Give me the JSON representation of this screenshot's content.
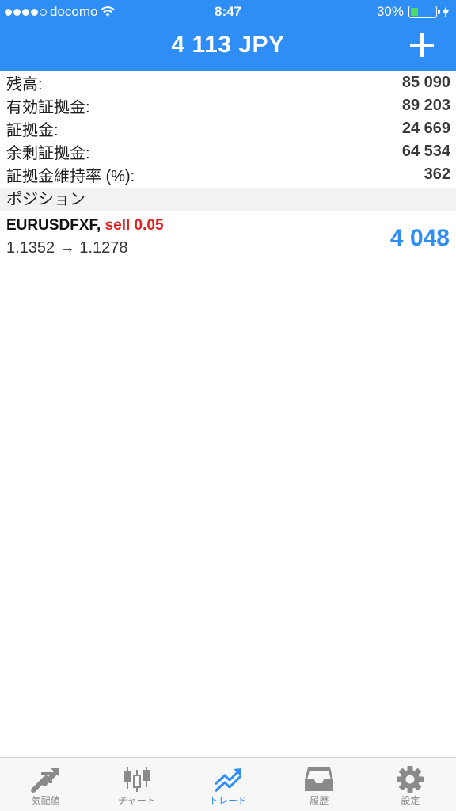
{
  "status_bar": {
    "carrier": "docomo",
    "time": "8:47",
    "battery": "30%",
    "battery_level": 0.3
  },
  "header": {
    "title": "4 113 JPY",
    "add_icon": "plus-icon"
  },
  "account": [
    {
      "label": "残高:",
      "value": "85 090"
    },
    {
      "label": "有効証拠金:",
      "value": "89 203"
    },
    {
      "label": "証拠金:",
      "value": "24 669"
    },
    {
      "label": "余剰証拠金:",
      "value": "64 534"
    },
    {
      "label": "証拠金維持率 (%):",
      "value": "362"
    }
  ],
  "positions_section": {
    "title": "ポジション"
  },
  "position": {
    "symbol": "EURUSDFXF,",
    "side": "sell 0.05",
    "prices": "1.1352 → 1.1278",
    "profit": "4 048"
  },
  "tabs": [
    {
      "label": "気配値",
      "icon": "quotes-arrows-icon",
      "active": false
    },
    {
      "label": "チャート",
      "icon": "candlestick-chart-icon",
      "active": false
    },
    {
      "label": "トレード",
      "icon": "trade-trend-icon",
      "active": true
    },
    {
      "label": "履歴",
      "icon": "history-inbox-icon",
      "active": false
    },
    {
      "label": "設定",
      "icon": "settings-gear-icon",
      "active": false
    }
  ],
  "colors": {
    "accent": "#2f8df6",
    "sell": "#e3201e",
    "tab_inactive": "#8a8a8a"
  }
}
